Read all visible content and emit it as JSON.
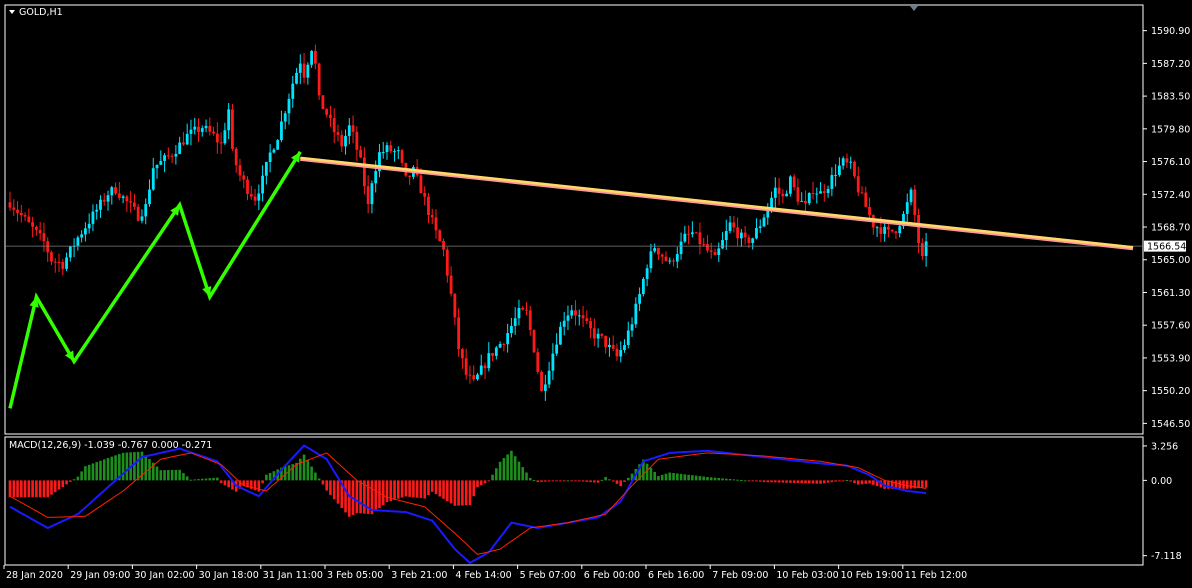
{
  "header": {
    "symbol_label": "GOLD,H1"
  },
  "colors": {
    "background": "#000000",
    "bull": "#00e5ff",
    "bear": "#ff1a1a",
    "trend_arrows": "#33ff00",
    "resistance_line": "#ffd966",
    "macd_line": "#1a1aff",
    "signal_line": "#ff2200",
    "hist_pos": "#1e8f1e",
    "hist_neg": "#ff1a1a",
    "axis": "#ffffff"
  },
  "chart_data": [
    {
      "type": "candlestick",
      "name": "main",
      "price_axis": {
        "ticks": [
          "1590.90",
          "1587.20",
          "1583.50",
          "1579.80",
          "1576.10",
          "1572.40",
          "1568.70",
          "1565.00",
          "1561.30",
          "1557.60",
          "1553.90",
          "1550.20",
          "1546.50"
        ],
        "ylim": [
          1545.3,
          1593.8
        ],
        "current_price": "1566.54"
      },
      "time_axis": {
        "ticks": [
          "28 Jan 2020",
          "29 Jan 09:00",
          "30 Jan 02:00",
          "30 Jan 18:00",
          "31 Jan 11:00",
          "3 Feb 05:00",
          "3 Feb 21:00",
          "4 Feb 14:00",
          "5 Feb 07:00",
          "6 Feb 00:00",
          "6 Feb 16:00",
          "7 Feb 09:00",
          "10 Feb 03:00",
          "10 Feb 19:00",
          "11 Feb 12:00"
        ]
      },
      "keypoints": [
        [
          0,
          1571.5
        ],
        [
          5,
          1569
        ],
        [
          9,
          1567
        ],
        [
          11,
          1565
        ],
        [
          14,
          1564.5
        ],
        [
          18,
          1567.5
        ],
        [
          22,
          1570
        ],
        [
          26,
          1572.5
        ],
        [
          28,
          1573
        ],
        [
          31,
          1571.5
        ],
        [
          34,
          1570
        ],
        [
          36,
          1571
        ],
        [
          38,
          1575.5
        ],
        [
          40,
          1576
        ],
        [
          43,
          1577
        ],
        [
          45,
          1578
        ],
        [
          47,
          1579
        ],
        [
          49,
          1579.5
        ],
        [
          51,
          1580
        ],
        [
          54,
          1579
        ],
        [
          56,
          1578
        ],
        [
          58,
          1582
        ],
        [
          59,
          1577
        ],
        [
          61,
          1574.5
        ],
        [
          63,
          1573
        ],
        [
          65,
          1572
        ],
        [
          67,
          1574
        ],
        [
          69,
          1577
        ],
        [
          71,
          1579
        ],
        [
          73,
          1582
        ],
        [
          75,
          1585
        ],
        [
          77,
          1587.5
        ],
        [
          78,
          1586
        ],
        [
          80,
          1589
        ],
        [
          81,
          1587
        ],
        [
          82,
          1583
        ],
        [
          84,
          1581.5
        ],
        [
          86,
          1579.5
        ],
        [
          88,
          1578
        ],
        [
          90,
          1580
        ],
        [
          91,
          1579
        ],
        [
          93,
          1576
        ],
        [
          95,
          1571
        ],
        [
          96,
          1574
        ],
        [
          98,
          1577
        ],
        [
          100,
          1577.5
        ],
        [
          103,
          1577
        ],
        [
          105,
          1574
        ],
        [
          107,
          1575
        ],
        [
          109,
          1573
        ],
        [
          111,
          1570.5
        ],
        [
          113,
          1568
        ],
        [
          115,
          1566
        ],
        [
          117,
          1561
        ],
        [
          119,
          1555
        ],
        [
          121,
          1552
        ],
        [
          123,
          1551
        ],
        [
          125,
          1552.5
        ],
        [
          127,
          1554
        ],
        [
          129,
          1555
        ],
        [
          131,
          1556
        ],
        [
          133,
          1557.5
        ],
        [
          135,
          1559
        ],
        [
          137,
          1559
        ],
        [
          139,
          1555
        ],
        [
          141,
          1550
        ],
        [
          143,
          1553
        ],
        [
          145,
          1556
        ],
        [
          147,
          1558.5
        ],
        [
          149,
          1559.5
        ],
        [
          151,
          1558.5
        ],
        [
          153,
          1557.5
        ],
        [
          155,
          1556.5
        ],
        [
          157,
          1556
        ],
        [
          159,
          1555
        ],
        [
          161,
          1554
        ],
        [
          163,
          1555.5
        ],
        [
          165,
          1558
        ],
        [
          167,
          1561
        ],
        [
          169,
          1564.5
        ],
        [
          171,
          1566.5
        ],
        [
          173,
          1565.5
        ],
        [
          175,
          1564.5
        ],
        [
          177,
          1566
        ],
        [
          179,
          1567.5
        ],
        [
          181,
          1568
        ],
        [
          183,
          1567
        ],
        [
          185,
          1566
        ],
        [
          187,
          1565
        ],
        [
          189,
          1567
        ],
        [
          191,
          1569
        ],
        [
          193,
          1568
        ],
        [
          195,
          1567
        ],
        [
          197,
          1567.5
        ],
        [
          199,
          1569
        ],
        [
          201,
          1571
        ],
        [
          203,
          1573
        ],
        [
          205,
          1572
        ],
        [
          207,
          1574
        ],
        [
          209,
          1572
        ],
        [
          211,
          1571
        ],
        [
          213,
          1573
        ],
        [
          215,
          1572.5
        ],
        [
          217,
          1573.5
        ],
        [
          219,
          1575
        ],
        [
          221,
          1576
        ],
        [
          223,
          1575.5
        ],
        [
          225,
          1573
        ],
        [
          227,
          1571
        ],
        [
          229,
          1569
        ],
        [
          231,
          1568.5
        ],
        [
          233,
          1568
        ],
        [
          235,
          1568.5
        ],
        [
          237,
          1570
        ],
        [
          239,
          1572.5
        ],
        [
          240,
          1570
        ],
        [
          241,
          1567
        ],
        [
          242,
          1565
        ],
        [
          243,
          1566.5
        ]
      ],
      "annotations": {
        "zigzag_arrows": [
          [
            0,
            1548.2
          ],
          [
            7,
            1560.8
          ],
          [
            17,
            1553.5
          ],
          [
            45,
            1571.2
          ],
          [
            53,
            1560.8
          ],
          [
            77,
            1577.2
          ]
        ],
        "resistance_line": {
          "from": [
            77,
            1576.4
          ],
          "to": "right_edge",
          "end_value": 1566.3
        }
      }
    },
    {
      "type": "macd",
      "name": "MACD(12,26,9)",
      "header_label": "MACD(12,26,9) -1.039 -0.767 0.000 -0.271",
      "y_ticks": [
        "3.256",
        "0.00",
        "-7.118"
      ],
      "ylim": [
        -8.0,
        4.1
      ],
      "macd_keypoints": [
        [
          0,
          -2.5
        ],
        [
          10,
          -4.5
        ],
        [
          18,
          -3.2
        ],
        [
          28,
          0.0
        ],
        [
          35,
          2.2
        ],
        [
          45,
          3.0
        ],
        [
          55,
          1.8
        ],
        [
          60,
          -0.5
        ],
        [
          66,
          -1.5
        ],
        [
          72,
          1.0
        ],
        [
          78,
          3.3
        ],
        [
          84,
          2.0
        ],
        [
          90,
          -1.5
        ],
        [
          96,
          -2.8
        ],
        [
          105,
          -3.0
        ],
        [
          112,
          -3.8
        ],
        [
          118,
          -6.5
        ],
        [
          122,
          -7.8
        ],
        [
          127,
          -6.8
        ],
        [
          133,
          -4.0
        ],
        [
          140,
          -4.5
        ],
        [
          148,
          -4.0
        ],
        [
          156,
          -3.5
        ],
        [
          162,
          -2.0
        ],
        [
          168,
          1.8
        ],
        [
          175,
          2.6
        ],
        [
          185,
          2.8
        ],
        [
          195,
          2.4
        ],
        [
          205,
          2.0
        ],
        [
          215,
          1.6
        ],
        [
          222,
          1.4
        ],
        [
          228,
          0.5
        ],
        [
          232,
          -0.5
        ],
        [
          238,
          -1.0
        ],
        [
          243,
          -1.2
        ]
      ],
      "signal_keypoints": [
        [
          0,
          -1.5
        ],
        [
          10,
          -3.5
        ],
        [
          20,
          -3.4
        ],
        [
          30,
          -1.0
        ],
        [
          40,
          2.0
        ],
        [
          48,
          2.6
        ],
        [
          56,
          1.5
        ],
        [
          62,
          -0.5
        ],
        [
          68,
          -1.0
        ],
        [
          76,
          1.5
        ],
        [
          84,
          2.6
        ],
        [
          92,
          0.0
        ],
        [
          100,
          -1.6
        ],
        [
          110,
          -2.5
        ],
        [
          118,
          -5.0
        ],
        [
          124,
          -7.0
        ],
        [
          130,
          -6.5
        ],
        [
          138,
          -4.5
        ],
        [
          148,
          -4.0
        ],
        [
          158,
          -3.2
        ],
        [
          165,
          -0.5
        ],
        [
          172,
          2.0
        ],
        [
          185,
          2.6
        ],
        [
          200,
          2.3
        ],
        [
          215,
          1.8
        ],
        [
          225,
          1.2
        ],
        [
          232,
          0.0
        ],
        [
          238,
          -0.5
        ],
        [
          243,
          -0.77
        ]
      ]
    }
  ]
}
